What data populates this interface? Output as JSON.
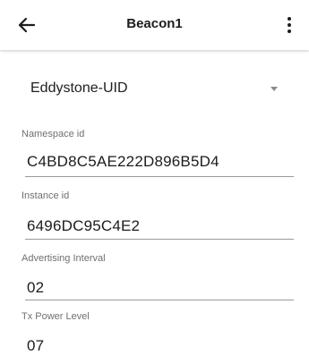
{
  "appbar": {
    "title": "Beacon1"
  },
  "beacon_type": {
    "selected": "Eddystone-UID"
  },
  "fields": [
    {
      "label": "Namespace id",
      "value": "C4BD8C5AE222D896B5D4"
    },
    {
      "label": "Instance id",
      "value": "6496DC95C4E2"
    },
    {
      "label": "Advertising Interval",
      "value": "02"
    },
    {
      "label": "Tx Power Level",
      "value": "07"
    }
  ],
  "icons": {
    "back": "arrow-back-icon",
    "menu": "more-vert-icon",
    "dropdown": "dropdown-caret-icon"
  }
}
